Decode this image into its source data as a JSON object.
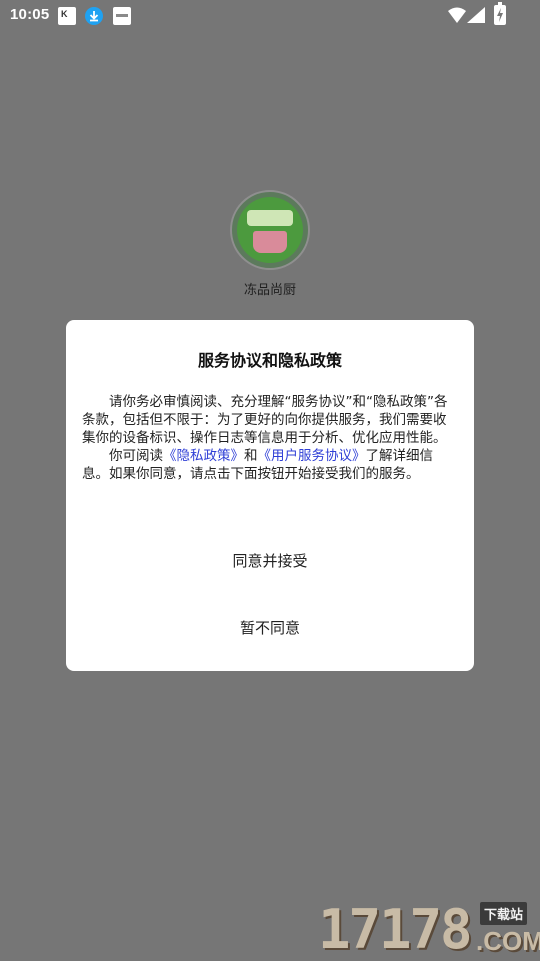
{
  "status_bar": {
    "time": "10:05",
    "notification_icons": [
      "app-notification-icon",
      "download-icon",
      "app-notification-icon"
    ],
    "system_icons": [
      "wifi-icon",
      "signal-icon",
      "battery-charging-icon"
    ]
  },
  "app": {
    "name": "冻品尚厨",
    "logo_icon": "app-logo"
  },
  "dialog": {
    "title": "服务协议和隐私政策",
    "paragraph1": "请你务必审慎阅读、充分理解“服务协议”和“隐私政策”各条款，包括但不限于：为了更好的向你提供服务，我们需要收集你的设备标识、操作日志等信息用于分析、优化应用性能。",
    "paragraph2_prefix": "你可阅读",
    "privacy_link": "《隐私政策》",
    "and_text": "和",
    "service_link": "《用户服务协议》",
    "paragraph2_suffix": "了解详细信息。如果你同意，请点击下面按钮开始接受我们的服务。",
    "agree_button": "同意并接受",
    "disagree_button": "暂不同意"
  },
  "watermark": {
    "number": "17178",
    "tag": "下载站",
    "domain": ".COM"
  },
  "colors": {
    "overlay": "#767676",
    "dialog_bg": "#ffffff",
    "link": "#2f3fd6"
  }
}
